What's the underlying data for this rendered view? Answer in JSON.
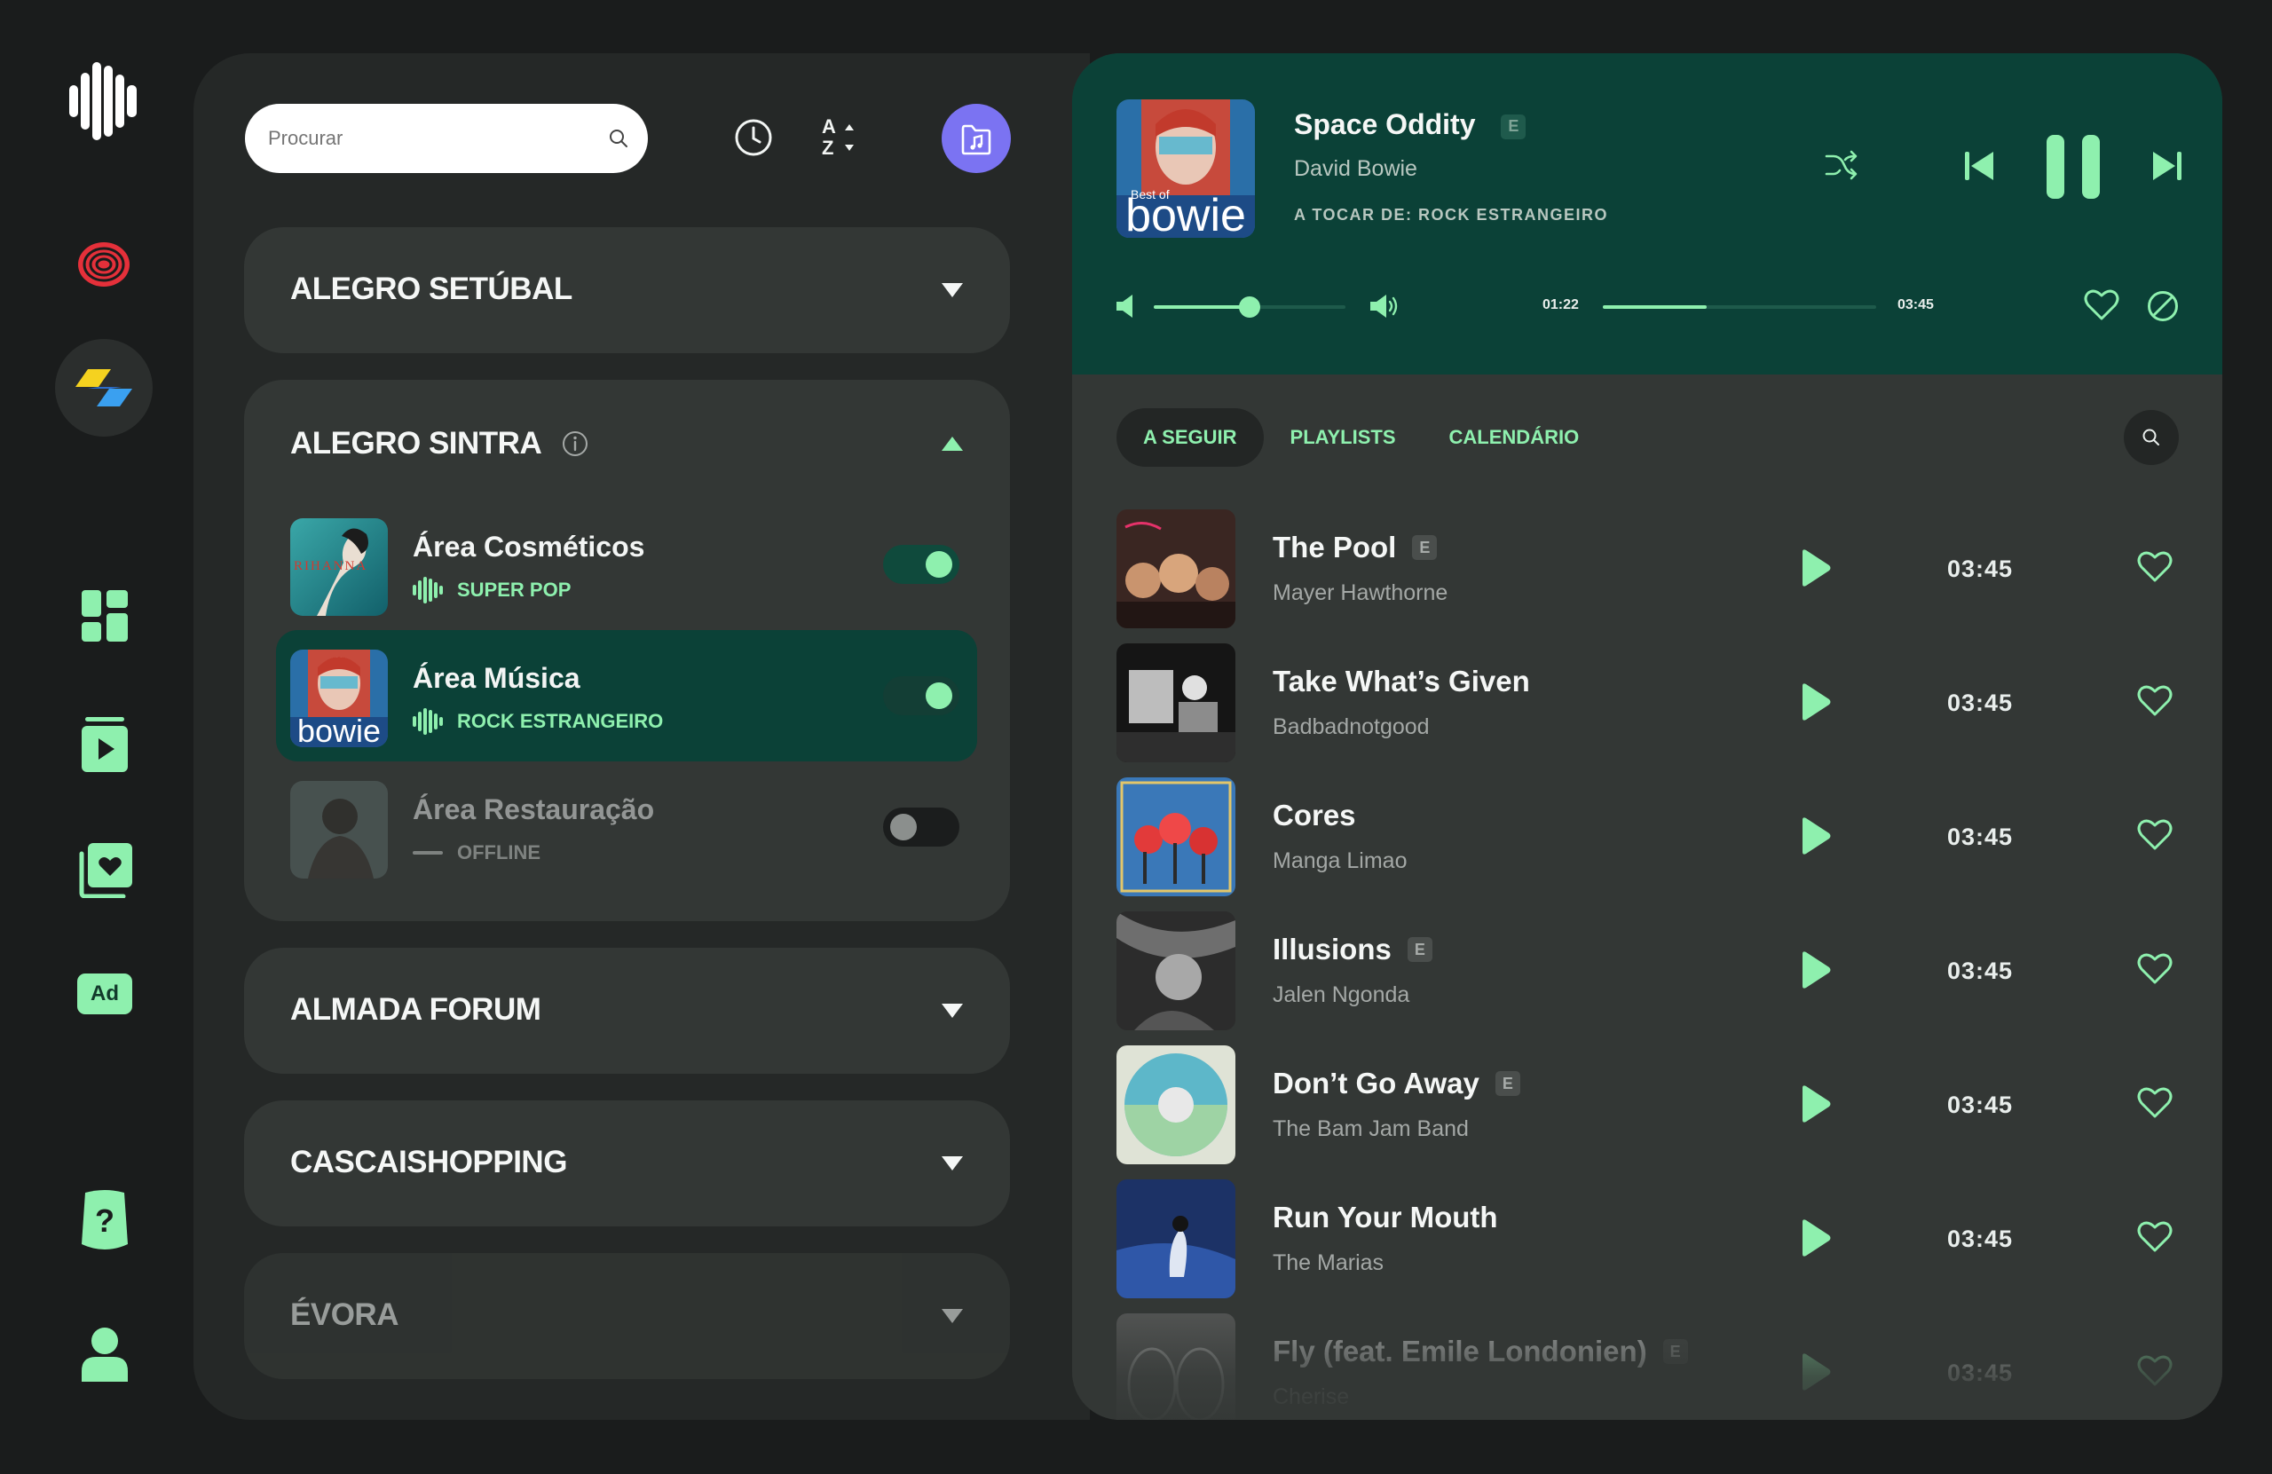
{
  "search": {
    "placeholder": "Procurar"
  },
  "stores": [
    {
      "name": "ALEGRO SETÚBAL"
    },
    {
      "name": "ALEGRO SINTRA",
      "areas": [
        {
          "name": "Área Cosméticos",
          "genre": "SUPER POP",
          "enabled": true,
          "cover_text": "RIHANNA"
        },
        {
          "name": "Área Música",
          "genre": "ROCK ESTRANGEIRO",
          "enabled": true,
          "cover_text": "bowie"
        },
        {
          "name": "Área Restauração",
          "genre": "OFFLINE",
          "enabled": false
        }
      ]
    },
    {
      "name": "ALMADA FORUM"
    },
    {
      "name": "CASCAISHOPPING"
    },
    {
      "name": "ÉVORA"
    }
  ],
  "sort": {
    "top": "A",
    "bottom": "Z"
  },
  "sidebar": {
    "ad_label": "Ad",
    "help_label": "?"
  },
  "now_playing": {
    "title": "Space Oddity",
    "explicit": "E",
    "artist": "David Bowie",
    "source": "A TOCAR DE: ROCK ESTRANGEIRO",
    "cover_text": "bowie",
    "cover_small_text": "Best of",
    "elapsed": "01:22",
    "duration": "03:45",
    "progress": 0.38,
    "volume": 0.5
  },
  "tabs": [
    "A SEGUIR",
    "PLAYLISTS",
    "CALENDÁRIO"
  ],
  "queue": [
    {
      "title": "The Pool",
      "artist": "Mayer Hawthorne",
      "explicit": "E",
      "duration": "03:45"
    },
    {
      "title": "Take What’s Given",
      "artist": "Badbadnotgood",
      "explicit": "",
      "duration": "03:45"
    },
    {
      "title": "Cores",
      "artist": "Manga Limao",
      "explicit": "",
      "duration": "03:45"
    },
    {
      "title": "Illusions",
      "artist": "Jalen Ngonda",
      "explicit": "E",
      "duration": "03:45"
    },
    {
      "title": "Don’t Go Away",
      "artist": "The Bam Jam Band",
      "explicit": "E",
      "duration": "03:45"
    },
    {
      "title": "Run Your Mouth",
      "artist": "The Marias",
      "explicit": "",
      "duration": "03:45"
    },
    {
      "title": "Fly (feat. Emile Londonien)",
      "artist": "Cherise",
      "explicit": "E",
      "duration": "03:45"
    }
  ],
  "colors": {
    "accent": "#8ef0ae",
    "player_bg": "#0b4137",
    "panel_bg": "#333735",
    "purple": "#7b73f2"
  }
}
